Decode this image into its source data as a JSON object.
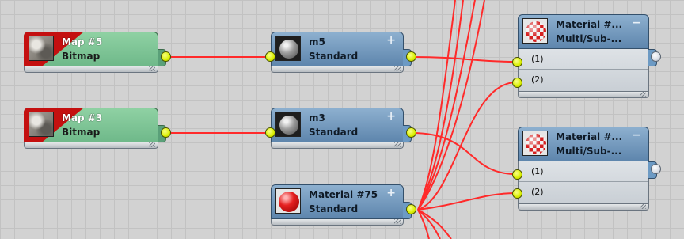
{
  "nodes": {
    "map5": {
      "name": "Map #5",
      "type": "Bitmap"
    },
    "map3": {
      "name": "Map #3",
      "type": "Bitmap"
    },
    "m5": {
      "name": "m5",
      "type": "Standard",
      "button": "+"
    },
    "m3": {
      "name": "m3",
      "type": "Standard",
      "button": "+"
    },
    "mat75": {
      "name": "Material #75",
      "type": "Standard",
      "button": "+"
    },
    "multi_a": {
      "name": "Material #...",
      "type": "Multi/Sub-...",
      "button": "−",
      "slots": [
        "(1)",
        "(2)"
      ]
    },
    "multi_b": {
      "name": "Material #...",
      "type": "Multi/Sub-...",
      "button": "−",
      "slots": [
        "(1)",
        "(2)"
      ]
    }
  },
  "colors": {
    "wire": "#ff2a2a",
    "socket_output": "#d9ef00",
    "map_node": "#6fb98a",
    "material_node": "#5e86ad",
    "bitmap_flag": "#c41010"
  },
  "icons": {
    "map_thumb": "rock-texture-icon",
    "standard_thumb": "gray-sphere-icon",
    "red_thumb": "red-sphere-icon",
    "multi_thumb": "checker-sphere-icon"
  }
}
